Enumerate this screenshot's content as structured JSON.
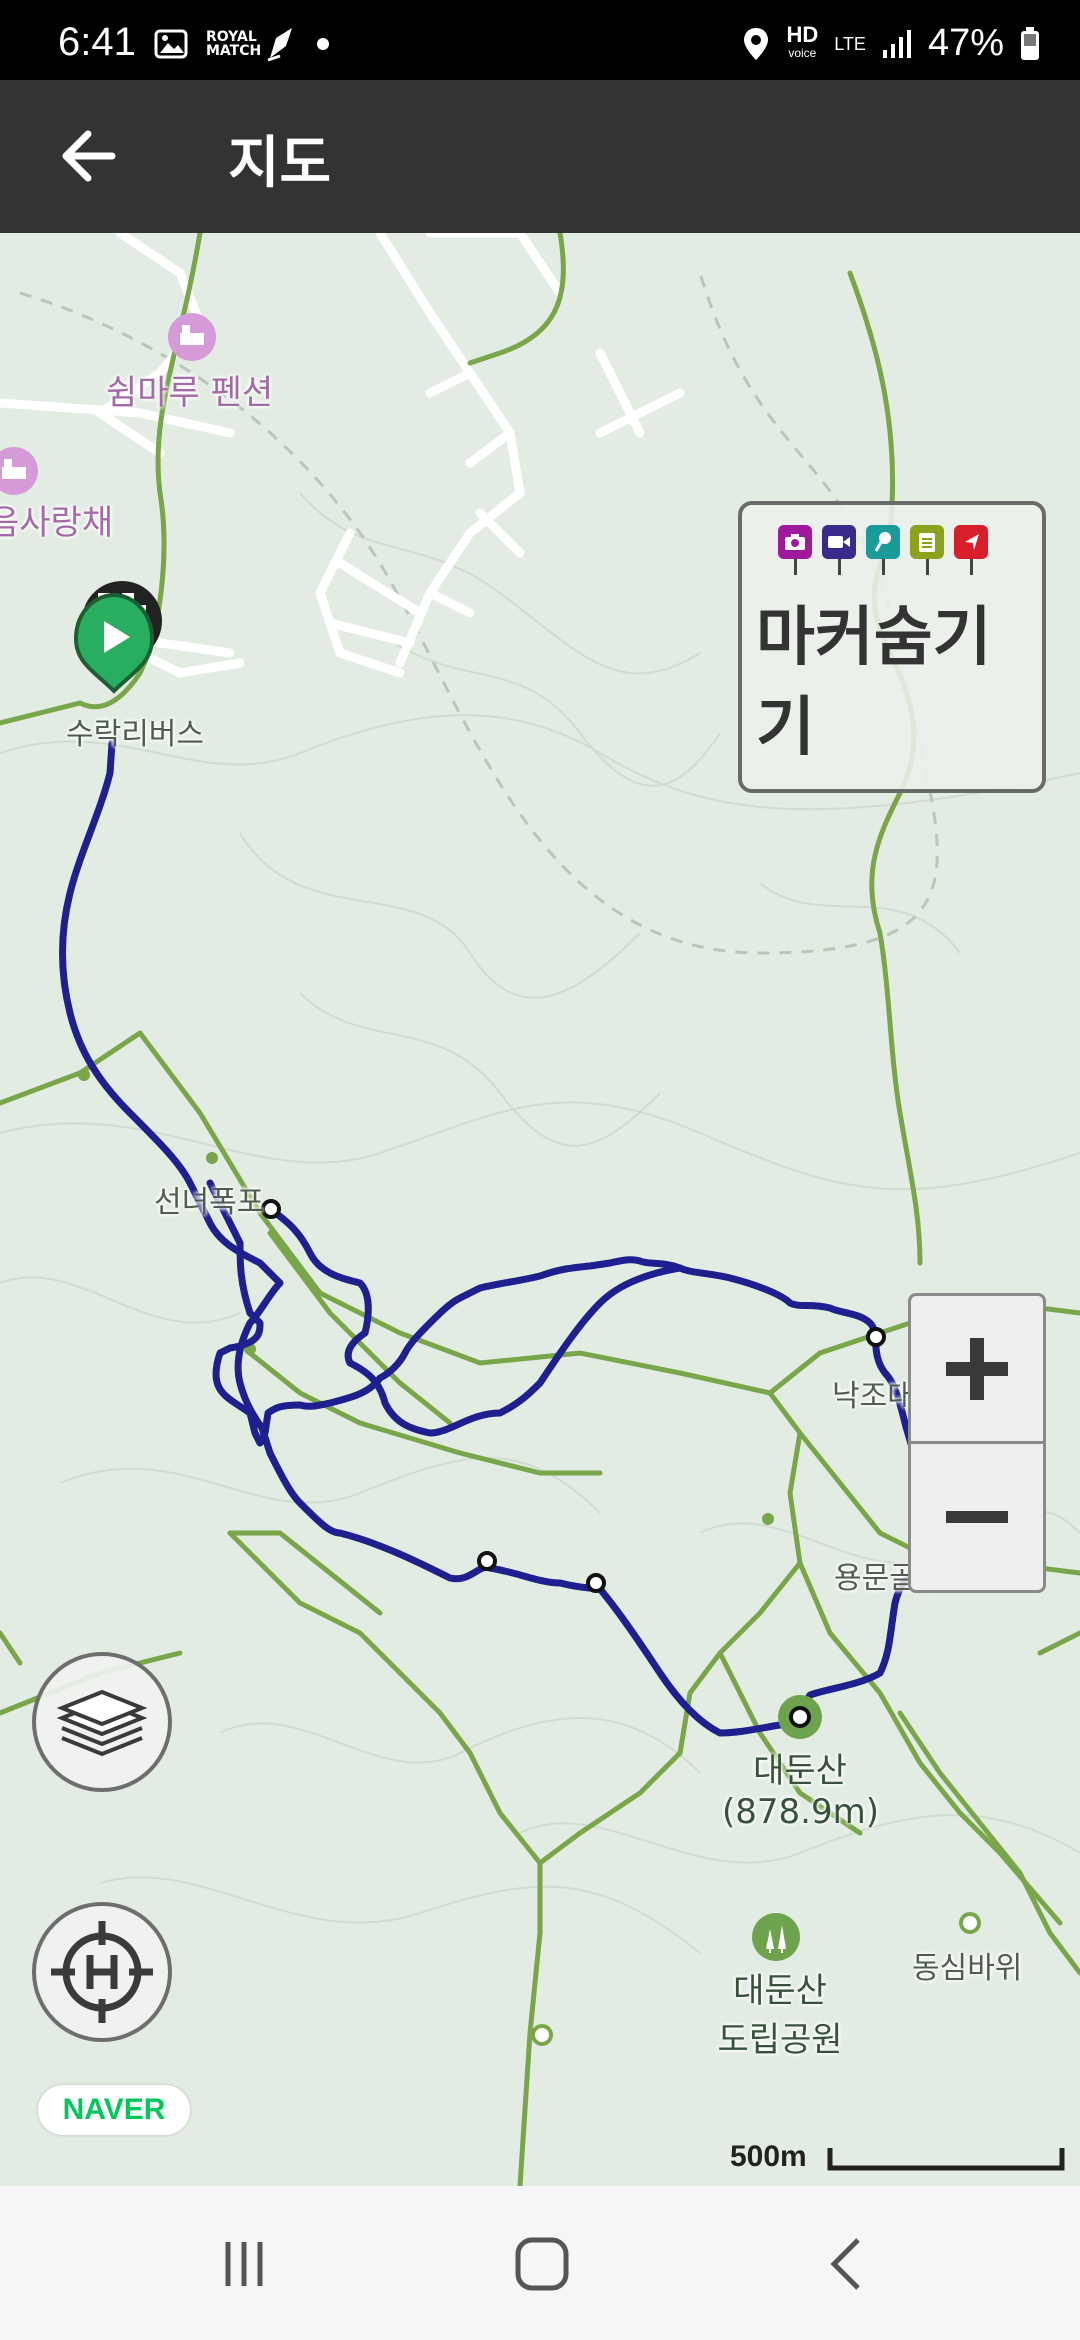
{
  "status_bar": {
    "time": "6:41",
    "left_icons": [
      "gallery-icon",
      "royal-match-icon",
      "pen-app-icon",
      "dot-icon"
    ],
    "royal_match_text": "ROYAL MATCH",
    "hd_label": "HD",
    "hd_sub": "voice",
    "network": "LTE",
    "battery": "47%"
  },
  "app_bar": {
    "title": "지도",
    "back_icon": "arrow-left-icon"
  },
  "map": {
    "labels": {
      "pension": "쉼마루 펜션",
      "lodging2": "음사랑채",
      "bus_stop": "수락리버스",
      "waterfall": "선녀폭포",
      "nakjodae": "낙조대",
      "junction": "용문골삼거리",
      "peak_name": "대둔산",
      "peak_elevation": "(878.9m)",
      "park_line1": "대둔산",
      "park_line2": "도립공원",
      "rock": "동심바위"
    },
    "colors": {
      "track": "#1f1f8f",
      "trail": "#7aa64a",
      "background": "#e3ece3"
    }
  },
  "marker_panel": {
    "label": "마커숨기기",
    "pins": [
      {
        "name": "camera-pin-icon",
        "color": "#a0189b"
      },
      {
        "name": "video-pin-icon",
        "color": "#3a2a8c"
      },
      {
        "name": "mic-pin-icon",
        "color": "#1a9a9a"
      },
      {
        "name": "note-pin-icon",
        "color": "#8da21b"
      },
      {
        "name": "flag-pin-icon",
        "color": "#d81e2a"
      }
    ]
  },
  "controls": {
    "zoom_in_icon": "plus-icon",
    "zoom_out_icon": "minus-icon",
    "layers_icon": "layers-icon",
    "recenter_icon": "crosshair-h-icon"
  },
  "branding": {
    "logo": "NAVER"
  },
  "scale": {
    "label": "500m"
  },
  "nav_bar": {
    "recents_icon": "recents-icon",
    "home_icon": "home-icon",
    "back_icon": "back-chevron-icon"
  }
}
